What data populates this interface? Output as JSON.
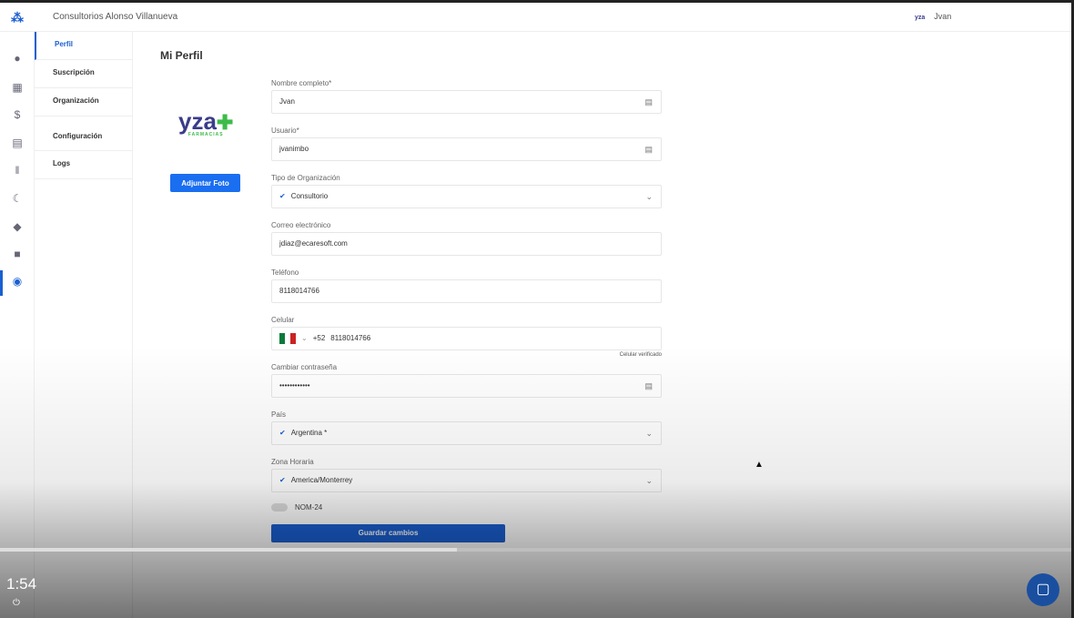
{
  "header": {
    "org_name": "Consultorios Alonso Villanueva",
    "user_logo": "yza",
    "user_name": "Jvan"
  },
  "submenu": [
    "Perfil",
    "Suscripción",
    "Organización",
    "Configuración",
    "Logs"
  ],
  "page_title": "Mi Perfil",
  "logo": {
    "text": "yza",
    "sub": "FARMACIAS"
  },
  "attach_photo": "Adjuntar Foto",
  "form": {
    "full_name": {
      "label": "Nombre completo*",
      "value": "Jvan"
    },
    "username": {
      "label": "Usuario*",
      "value": "jvanimbo"
    },
    "org_type": {
      "label": "Tipo de Organización",
      "value": "Consultorio"
    },
    "email": {
      "label": "Correo electrónico",
      "value": "jdiaz@ecaresoft.com"
    },
    "phone": {
      "label": "Teléfono",
      "value": "8118014766"
    },
    "mobile": {
      "label": "Celular",
      "code": "+52",
      "value": "8118014766",
      "verified": "Celular verificado"
    },
    "password": {
      "label": "Cambiar contraseña",
      "value": "••••••••••••"
    },
    "country": {
      "label": "País",
      "value": "Argentina *"
    },
    "timezone": {
      "label": "Zona Horaria",
      "value": "America/Monterrey"
    },
    "nom24": "NOM-24",
    "save": "Guardar cambios"
  },
  "video": {
    "time": "1:54",
    "progress": 0.425
  }
}
